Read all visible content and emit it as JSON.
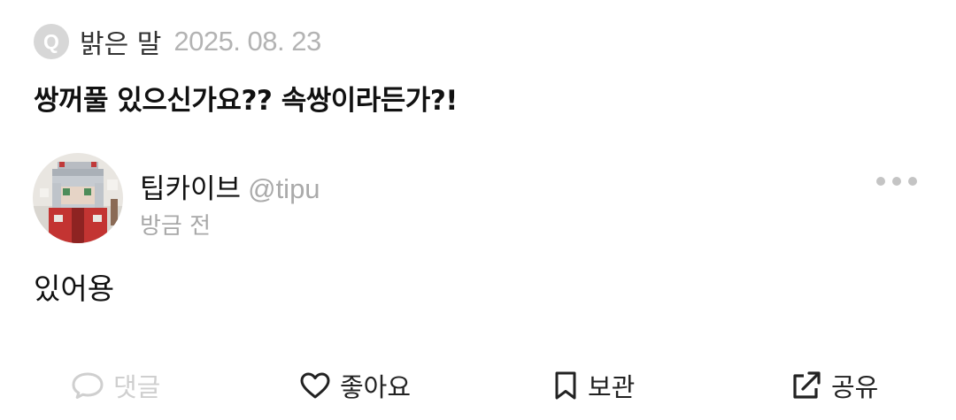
{
  "question": {
    "badge": "Q",
    "author": "밝은 말",
    "date": "2025. 08. 23",
    "text": "쌍꺼풀 있으신가요?? 속쌍이라든가?!"
  },
  "answer": {
    "author_name": "팁카이브",
    "handle": "@tipu",
    "time": "방금 전",
    "text": "있어용",
    "avatar_icon": "pixel-character-avatar"
  },
  "actions": [
    {
      "label": "댓글",
      "icon": "comment-icon",
      "enabled": false
    },
    {
      "label": "좋아요",
      "icon": "heart-icon",
      "enabled": true
    },
    {
      "label": "보관",
      "icon": "bookmark-icon",
      "enabled": true
    },
    {
      "label": "공유",
      "icon": "share-icon",
      "enabled": true
    }
  ],
  "colors": {
    "muted": "#b3b3b3",
    "disabled": "#cfcfcf",
    "text": "#111111"
  }
}
